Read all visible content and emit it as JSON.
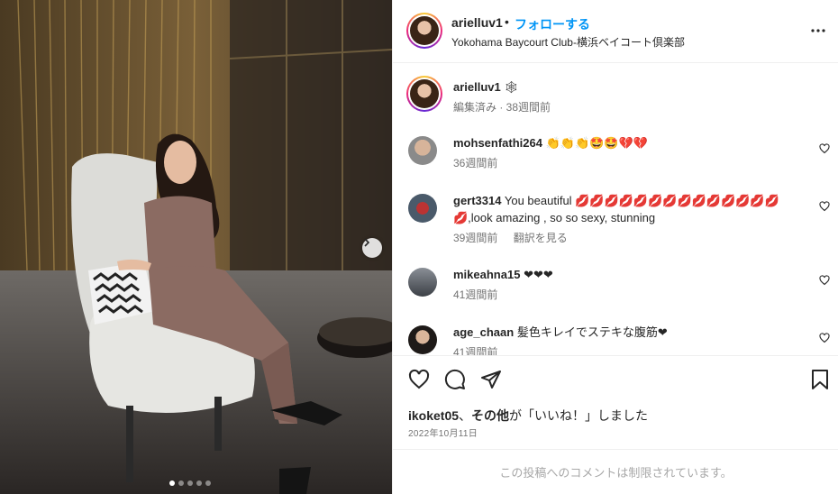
{
  "post": {
    "username": "arielluv1",
    "separator": "•",
    "follow_label": "フォローする",
    "location": "Yokohama Baycourt Club-横浜ベイコート倶楽部"
  },
  "caption": {
    "username": "arielluv1",
    "emoji": "🕸",
    "meta": "編集済み · 38週間前"
  },
  "comments": [
    {
      "username": "mohsenfathi264",
      "text": "👏👏👏🤩🤩💔💔",
      "time": "36週間前",
      "translate": ""
    },
    {
      "username": "gert3314",
      "text": "You beautiful 💋💋💋💋💋💋💋💋💋💋💋💋💋💋💋,look amazing , so so sexy, stunning",
      "time": "39週間前",
      "translate": "翻訳を見る"
    },
    {
      "username": "mikeahna15",
      "text": "❤❤❤",
      "time": "41週間前",
      "translate": ""
    },
    {
      "username": "age_chaan",
      "text": "髪色キレイでステキな腹筋❤",
      "time": "41週間前",
      "translate": ""
    }
  ],
  "likes": {
    "user": "ikoket05",
    "sep": "、",
    "others": "その他",
    "suffix": "が「いいね！」しました"
  },
  "date": "2022年10月11日",
  "restricted_text": "この投稿へのコメントは制限されています。",
  "carousel": {
    "count": 5,
    "active": 1
  },
  "colors": {
    "accent": "#0095f6",
    "text": "#262626",
    "muted": "#737373"
  }
}
